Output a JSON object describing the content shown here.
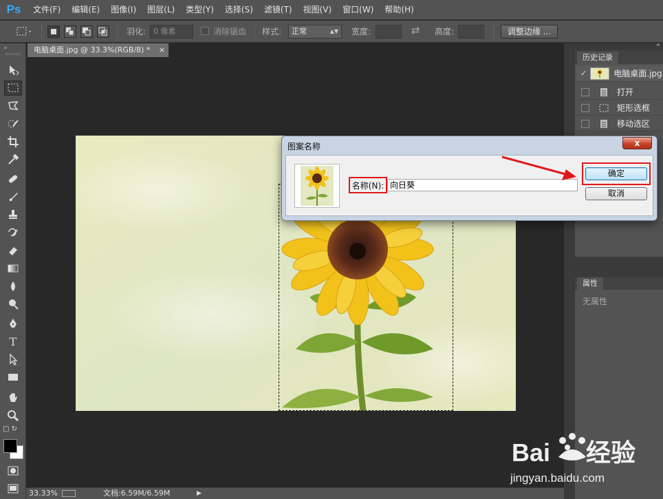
{
  "app": {
    "logo": "Ps"
  },
  "menu": [
    "文件(F)",
    "编辑(E)",
    "图像(I)",
    "图层(L)",
    "类型(Y)",
    "选择(S)",
    "滤镜(T)",
    "视图(V)",
    "窗口(W)",
    "帮助(H)"
  ],
  "options": {
    "feather_label": "羽化:",
    "feather_value": "0 像素",
    "antialias_label": "消除锯齿",
    "style_label": "样式:",
    "style_value": "正常",
    "width_label": "宽度:",
    "height_label": "高度:",
    "refine_edge_label": "调整边缘 ..."
  },
  "document": {
    "tab_title": "电脑桌面.jpg @ 33.3%(RGB/8) *",
    "tab_close": "×"
  },
  "status": {
    "zoom": "33.33%",
    "doc_info": "文档:6.59M/6.59M"
  },
  "panels": {
    "history_tab": "历史记录",
    "history_snapshot": "电脑桌面.jpg",
    "history_items": [
      "打开",
      "矩形选框",
      "移动选区"
    ],
    "properties_tab": "属性",
    "properties_empty": "无属性"
  },
  "dialog": {
    "title": "图案名称",
    "close_symbol": "x",
    "name_label": "名称(N):",
    "name_value": "向日葵",
    "ok_label": "确定",
    "cancel_label": "取消"
  },
  "watermark": {
    "brand": "Baidu经验",
    "url": "jingyan.baidu.com"
  },
  "colors": {
    "ui_dark": "#282828",
    "ui_panel": "#535353",
    "highlight_red": "#e1181b",
    "ps_blue": "#31a8ff"
  }
}
